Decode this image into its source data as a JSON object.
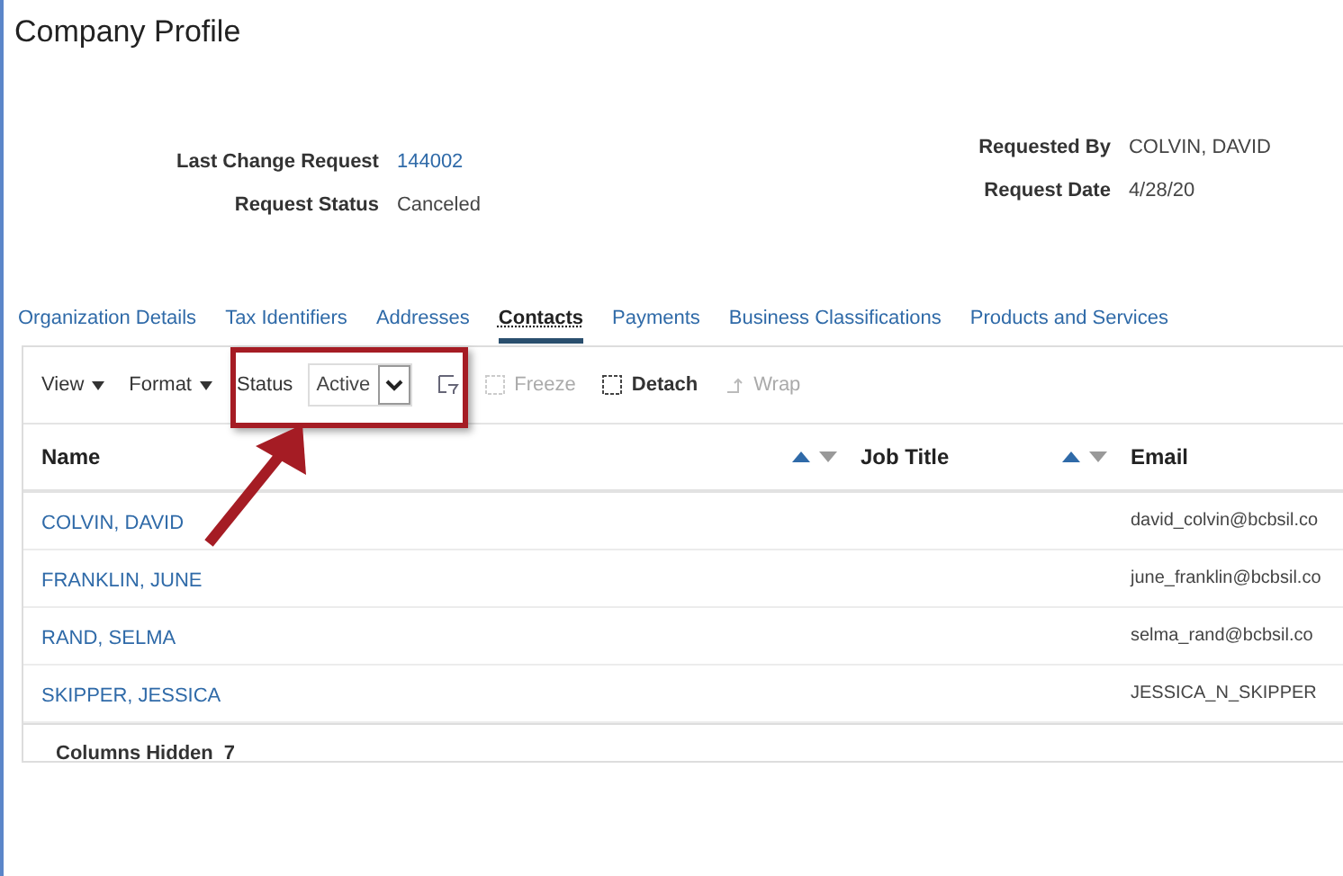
{
  "title": "Company Profile",
  "header_left": [
    {
      "label": "Last Change Request",
      "value": "144002",
      "kind": "link"
    },
    {
      "label": "Request Status",
      "value": "Canceled",
      "kind": "text"
    }
  ],
  "header_right": [
    {
      "label": "Requested By",
      "value": "COLVIN, DAVID"
    },
    {
      "label": "Request Date",
      "value": "4/28/20"
    }
  ],
  "tabs": [
    {
      "label": "Organization Details",
      "selected": false
    },
    {
      "label": "Tax Identifiers",
      "selected": false
    },
    {
      "label": "Addresses",
      "selected": false
    },
    {
      "label": "Contacts",
      "selected": true
    },
    {
      "label": "Payments",
      "selected": false
    },
    {
      "label": "Business Classifications",
      "selected": false
    },
    {
      "label": "Products and Services",
      "selected": false
    }
  ],
  "toolbar": [
    {
      "kind": "menu",
      "label": "View"
    },
    {
      "kind": "menu",
      "label": "Format"
    },
    {
      "kind": "select",
      "label": "Status",
      "value": "Active"
    },
    {
      "kind": "filter",
      "disabled": false
    },
    {
      "kind": "freeze",
      "label": "Freeze",
      "disabled": true
    },
    {
      "kind": "detach",
      "label": "Detach",
      "disabled": false
    },
    {
      "kind": "wrap",
      "label": "Wrap",
      "disabled": true
    }
  ],
  "table": {
    "columns": [
      {
        "label": "Name"
      },
      {
        "label": "Job Title"
      },
      {
        "label": "Email"
      }
    ],
    "rows": [
      {
        "name": "COLVIN, DAVID",
        "email": "david_colvin@bcbsil.co"
      },
      {
        "name": "FRANKLIN, JUNE",
        "email": "june_franklin@bcbsil.co"
      },
      {
        "name": "RAND, SELMA",
        "email": "selma_rand@bcbsil.co"
      },
      {
        "name": "SKIPPER, JESSICA",
        "email": "JESSICA_N_SKIPPER"
      }
    ],
    "footer": {
      "label": "Columns Hidden",
      "value": "7"
    }
  }
}
